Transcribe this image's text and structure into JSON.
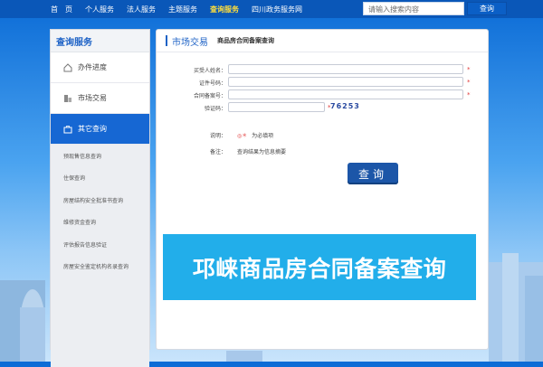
{
  "nav": {
    "items": [
      "首　页",
      "个人服务",
      "法人服务",
      "主题服务",
      "查询服务",
      "四川政务服务网"
    ],
    "active_index": 4
  },
  "search": {
    "placeholder": "请输入搜索内容",
    "button": "查询"
  },
  "sidebar": {
    "title": "查询服务",
    "items": [
      {
        "label": "办件进度",
        "icon": "home-icon"
      },
      {
        "label": "市场交易",
        "icon": "building-icon"
      },
      {
        "label": "其它查询",
        "icon": "briefcase-icon",
        "active": true
      }
    ],
    "subitems": [
      "预现售信息查询",
      "住保查询",
      "房屋结构安全批准书查询",
      "维修资金查询",
      "评估报告信息验证",
      "房屋安全鉴定机构名录查询"
    ]
  },
  "main": {
    "section_title": "市场交易",
    "breadcrumb": "商品房合同备案查询",
    "form": {
      "buyer_name_label": "买受人姓名：",
      "id_number_label": "证件号码：",
      "contract_no_label": "合同备案号：",
      "captcha_label": "验证码：",
      "captcha_text": "76253",
      "note_label": "说明：",
      "required_mark": "◎＊",
      "required_text": "为必填项",
      "remark_label": "备注：",
      "remark_text": "查询结果为信息摘要"
    },
    "query_button": "查询"
  },
  "banner": {
    "text": "邛崃商品房合同备案查询"
  },
  "colors": {
    "nav_bg": "#0a57b8",
    "nav_active": "#ffde3b",
    "accent": "#1f63c6",
    "button": "#1c56a8",
    "banner": "#22aeea",
    "required": "#e03a3a"
  }
}
